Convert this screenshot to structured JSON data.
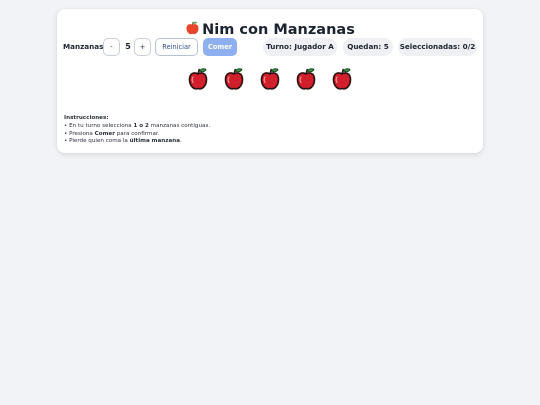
{
  "game": {
    "title_icon": "apple-icon",
    "title": "Nim con Manzanas"
  },
  "controls": {
    "apples_label": "Manzanas:",
    "decrement_label": "-",
    "apple_count": "5",
    "increment_label": "+",
    "reset_label": "Reiniciar",
    "eat_label": "Comer"
  },
  "status": {
    "turn": "Turno: Jugador A",
    "remaining": "Quedan: 5",
    "selected": "Seleccionadas: 0/2"
  },
  "board": {
    "apples": [
      {
        "id": 1,
        "selected": false
      },
      {
        "id": 2,
        "selected": false
      },
      {
        "id": 3,
        "selected": false
      },
      {
        "id": 4,
        "selected": false
      },
      {
        "id": 5,
        "selected": false
      }
    ],
    "apple_color": "#d11f2b",
    "leaf_color": "#2f9e44"
  },
  "instructions": {
    "heading": "Instrucciones:",
    "line1_pre": "• En tu turno selecciona ",
    "line1_bold": "1 o 2",
    "line1_post": " manzanas contiguas.",
    "line2_pre": "• Presiona ",
    "line2_bold": "Comer",
    "line2_post": " para confirmar.",
    "line3_pre": "• Pierde quien coma la ",
    "line3_bold": "última manzana",
    "line3_post": "."
  },
  "colors": {
    "accent": "#8fb0f0",
    "background": "#f2f3f6",
    "card": "#ffffff"
  }
}
